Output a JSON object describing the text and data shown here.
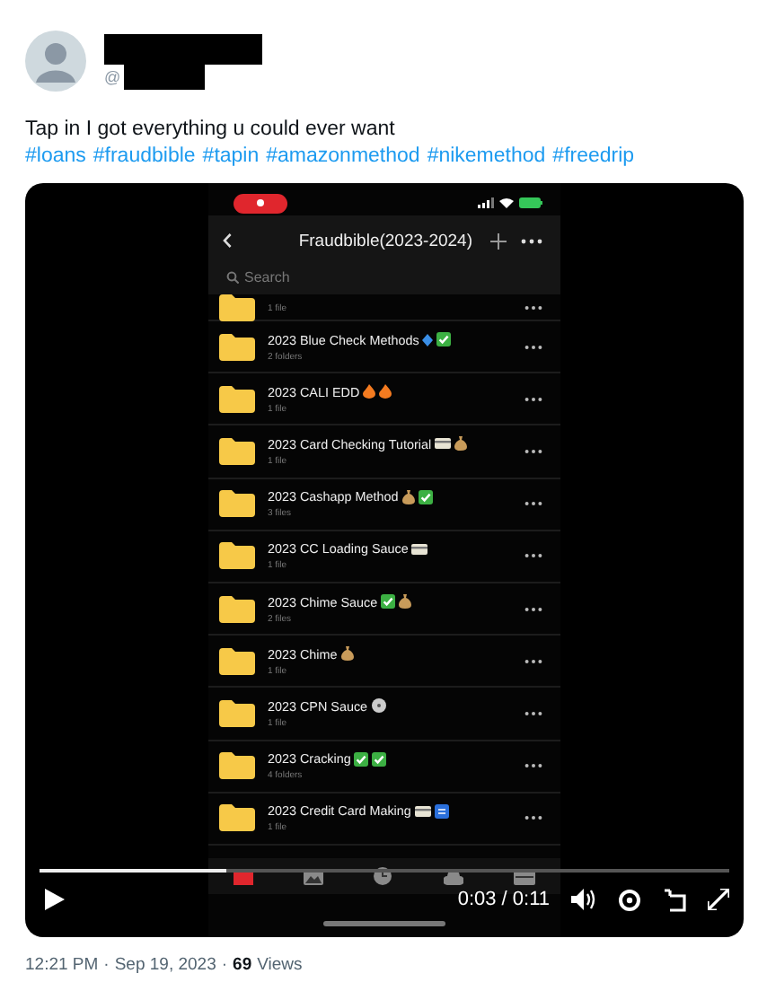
{
  "tweet": {
    "handle_prefix": "@",
    "text": "Tap in I got everything u could ever want",
    "hashtags": [
      "#loans",
      "#fraudbible",
      "#tapin",
      "#amazonmethod",
      "#nikemethod",
      "#freedrip"
    ]
  },
  "video": {
    "app": {
      "title": "Fraudbible(2023-2024)",
      "search_placeholder": "Search",
      "folders": [
        {
          "meta": "1 file"
        },
        {
          "name": "2023 Blue Check Methods",
          "meta": "2 folders",
          "badges": [
            {
              "kind": "diamond"
            },
            {
              "kind": "check"
            }
          ]
        },
        {
          "name": "2023 CALI EDD",
          "meta": "1 file",
          "badges": [
            {
              "kind": "fire"
            },
            {
              "kind": "fire"
            }
          ]
        },
        {
          "name": "2023 Card Checking Tutorial",
          "meta": "1 file",
          "badges": [
            {
              "kind": "card"
            },
            {
              "kind": "money"
            }
          ]
        },
        {
          "name": "2023 Cashapp Method",
          "meta": "3 files",
          "badges": [
            {
              "kind": "money"
            },
            {
              "kind": "check"
            }
          ]
        },
        {
          "name": "2023 CC Loading Sauce",
          "meta": "1 file",
          "badges": [
            {
              "kind": "card"
            }
          ]
        },
        {
          "name": "2023 Chime Sauce",
          "meta": "2 files",
          "badges": [
            {
              "kind": "check"
            },
            {
              "kind": "money"
            }
          ]
        },
        {
          "name": "2023 Chime",
          "meta": "1 file",
          "badges": [
            {
              "kind": "money"
            }
          ]
        },
        {
          "name": "2023 CPN Sauce",
          "meta": "1 file",
          "badges": [
            {
              "kind": "disc"
            }
          ]
        },
        {
          "name": "2023 Cracking",
          "meta": "4 folders",
          "badges": [
            {
              "kind": "check"
            },
            {
              "kind": "check"
            }
          ]
        },
        {
          "name": "2023 Credit Card Making",
          "meta": "1 file",
          "badges": [
            {
              "kind": "card"
            },
            {
              "kind": "flag"
            }
          ]
        }
      ],
      "toolbar": [
        {
          "kind": "folder",
          "selected": true
        },
        {
          "kind": "photo",
          "selected": false
        },
        {
          "kind": "clock",
          "selected": false
        },
        {
          "kind": "cloud",
          "selected": false
        },
        {
          "kind": "scan",
          "selected": false
        }
      ]
    },
    "progress": {
      "level": 0.27
    },
    "time": "0:03 / 0:11"
  },
  "footer": {
    "separator": "·",
    "time": "12:21 PM",
    "date": "Sep 19, 2023",
    "views_count": "69",
    "views_label": "Views"
  }
}
